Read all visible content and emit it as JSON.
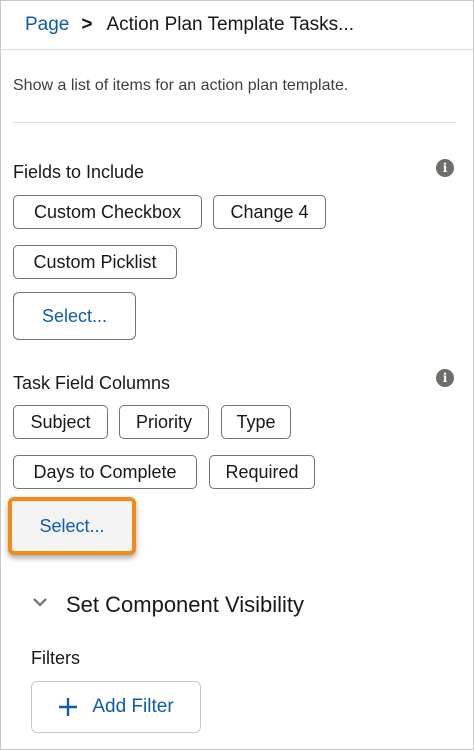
{
  "breadcrumb": {
    "parent": "Page",
    "separator": ">",
    "current": "Action Plan Template Tasks..."
  },
  "description": "Show a list of items for an action plan template.",
  "fields_to_include": {
    "label": "Fields to Include",
    "items": [
      "Custom Checkbox",
      "Change 4",
      "Custom Picklist"
    ],
    "select_label": "Select..."
  },
  "task_field_columns": {
    "label": "Task Field Columns",
    "items": [
      "Subject",
      "Priority",
      "Type",
      "Days to Complete",
      "Required"
    ],
    "select_label": "Select..."
  },
  "visibility": {
    "label": "Set Component Visibility",
    "filters_label": "Filters",
    "add_filter_label": "Add Filter"
  },
  "info_icon_glyph": "i",
  "colors": {
    "link": "#0b5cab",
    "highlight": "#f18a17",
    "border": "#747474"
  }
}
